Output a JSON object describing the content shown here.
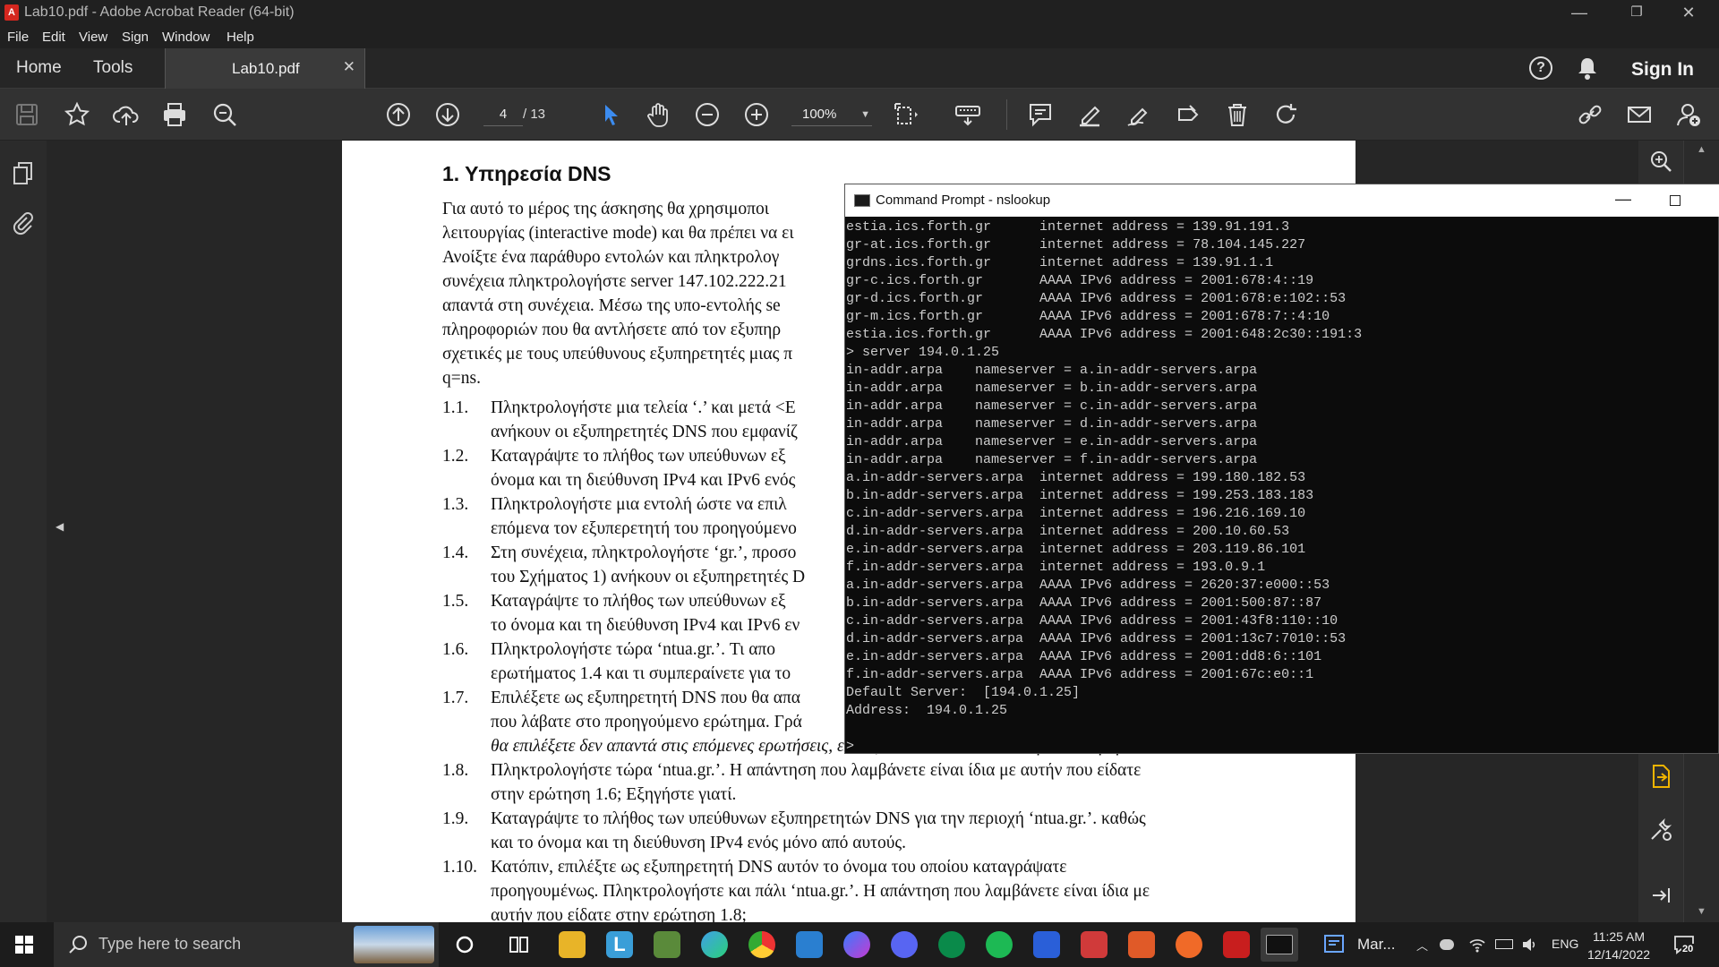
{
  "window": {
    "title": "Lab10.pdf - Adobe Acrobat Reader (64-bit)"
  },
  "menu": [
    "File",
    "Edit",
    "View",
    "Sign",
    "Window",
    "Help"
  ],
  "tabs": {
    "home": "Home",
    "tools": "Tools",
    "document": "Lab10.pdf",
    "sign_in": "Sign In"
  },
  "toolbar": {
    "page_current": "4",
    "page_total": "/ 13",
    "zoom": "100%"
  },
  "document": {
    "heading": "1. Υπηρεσία DNS",
    "intro_lines": [
      "Για αυτό το μέρος της άσκησης θα χρησιμοποι",
      "λειτουργίας (interactive mode) και θα πρέπει να ει",
      "Ανοίξτε ένα παράθυρο εντολών και πληκτρολογ",
      "συνέχεια πληκτρολογήστε server 147.102.222.21",
      "απαντά στη συνέχεια. Μέσω της υπο-εντολής se",
      "πληροφοριών που θα αντλήσετε από τον εξυπηρ",
      "σχετικές με τους υπεύθυνους εξυπηρετητές μιας π",
      "q=ns."
    ],
    "questions": [
      {
        "num": "1.1.",
        "lines": [
          "Πληκτρολογήστε μια τελεία ‘.’ και μετά <E",
          "ανήκουν οι εξυπηρετητές DNS που εμφανίζ"
        ]
      },
      {
        "num": "1.2.",
        "lines": [
          "Καταγράψτε το πλήθος των υπεύθυνων εξ",
          "όνομα και τη διεύθυνση IPv4 και IPv6 ενός"
        ]
      },
      {
        "num": "1.3.",
        "lines": [
          "Πληκτρολογήστε μια εντολή ώστε να επιλ",
          "επόμενα τον εξυπερετητή του προηγούμενο"
        ]
      },
      {
        "num": "1.4.",
        "lines": [
          "Στη συνέχεια, πληκτρολογήστε ‘gr.’, προσο",
          "του Σχήματος 1) ανήκουν οι εξυπηρετητές D"
        ]
      },
      {
        "num": "1.5.",
        "lines": [
          "Καταγράψτε το πλήθος των υπεύθυνων εξ",
          "το όνομα και τη διεύθυνση IPv4 και IPv6 εν"
        ]
      },
      {
        "num": "1.6.",
        "lines": [
          "Πληκτρολογήστε τώρα ‘ntua.gr.’. Τι απο",
          "ερωτήματος 1.4 και τι συμπεραίνετε για το"
        ]
      },
      {
        "num": "1.7.",
        "lines": [
          "Επιλέξετε ως εξυπηρετητή DNS που θα απα",
          "που λάβατε στο προηγούμενο ερώτημα. Γρά",
          "θα επιλέξετε δεν απαντά στις επόμενες ερωτήσεις, επιλέξτε κάποιον άλλο από την απάντηση.]"
        ]
      },
      {
        "num": "1.8.",
        "lines": [
          "Πληκτρολογήστε τώρα ‘ntua.gr.’. Η απάντηση που λαμβάνετε είναι ίδια με αυτήν που είδατε",
          "στην ερώτηση 1.6; Εξηγήστε γιατί."
        ]
      },
      {
        "num": "1.9.",
        "lines": [
          "Καταγράψτε το πλήθος των υπεύθυνων εξυπηρετητών DNS για την περιοχή ‘ntua.gr.’. καθώς",
          "και το όνομα και τη διεύθυνση IPv4 ενός μόνο από αυτούς."
        ]
      },
      {
        "num": "1.10.",
        "lines": [
          "Κατόπιν, επιλέξτε ως εξυπηρετητή DNS αυτόν το όνομα του οποίου καταγράψατε",
          "προηγουμένως. Πληκτρολογήστε και πάλι ‘ntua.gr.’. Η απάντηση που λαμβάνετε είναι ίδια με",
          "αυτήν που είδατε στην ερώτηση 1.8;"
        ]
      }
    ]
  },
  "cmd": {
    "title": "Command Prompt - nslookup",
    "lines": [
      "estia.ics.forth.gr      internet address = 139.91.191.3",
      "gr-at.ics.forth.gr      internet address = 78.104.145.227",
      "grdns.ics.forth.gr      internet address = 139.91.1.1",
      "gr-c.ics.forth.gr       AAAA IPv6 address = 2001:678:4::19",
      "gr-d.ics.forth.gr       AAAA IPv6 address = 2001:678:e:102::53",
      "gr-m.ics.forth.gr       AAAA IPv6 address = 2001:678:7::4:10",
      "estia.ics.forth.gr      AAAA IPv6 address = 2001:648:2c30::191:3",
      "> server 194.0.1.25",
      "in-addr.arpa    nameserver = a.in-addr-servers.arpa",
      "in-addr.arpa    nameserver = b.in-addr-servers.arpa",
      "in-addr.arpa    nameserver = c.in-addr-servers.arpa",
      "in-addr.arpa    nameserver = d.in-addr-servers.arpa",
      "in-addr.arpa    nameserver = e.in-addr-servers.arpa",
      "in-addr.arpa    nameserver = f.in-addr-servers.arpa",
      "a.in-addr-servers.arpa  internet address = 199.180.182.53",
      "b.in-addr-servers.arpa  internet address = 199.253.183.183",
      "c.in-addr-servers.arpa  internet address = 196.216.169.10",
      "d.in-addr-servers.arpa  internet address = 200.10.60.53",
      "e.in-addr-servers.arpa  internet address = 203.119.86.101",
      "f.in-addr-servers.arpa  internet address = 193.0.9.1",
      "a.in-addr-servers.arpa  AAAA IPv6 address = 2620:37:e000::53",
      "b.in-addr-servers.arpa  AAAA IPv6 address = 2001:500:87::87",
      "c.in-addr-servers.arpa  AAAA IPv6 address = 2001:43f8:110::10",
      "d.in-addr-servers.arpa  AAAA IPv6 address = 2001:13c7:7010::53",
      "e.in-addr-servers.arpa  AAAA IPv6 address = 2001:dd8:6::101",
      "f.in-addr-servers.arpa  AAAA IPv6 address = 2001:67c:e0::1",
      "Default Server:  [194.0.1.25]",
      "Address:  194.0.1.25",
      "",
      ">"
    ]
  },
  "taskbar": {
    "search_placeholder": "Type here to search",
    "tray_app": "Mar...",
    "lang": "ENG",
    "time": "11:25 AM",
    "date": "12/14/2022",
    "notifications": "20"
  },
  "colors": {
    "acrobat_red": "#d4271f",
    "pdf_bg": "#262626",
    "terminal_bg": "#0c0c0c"
  }
}
